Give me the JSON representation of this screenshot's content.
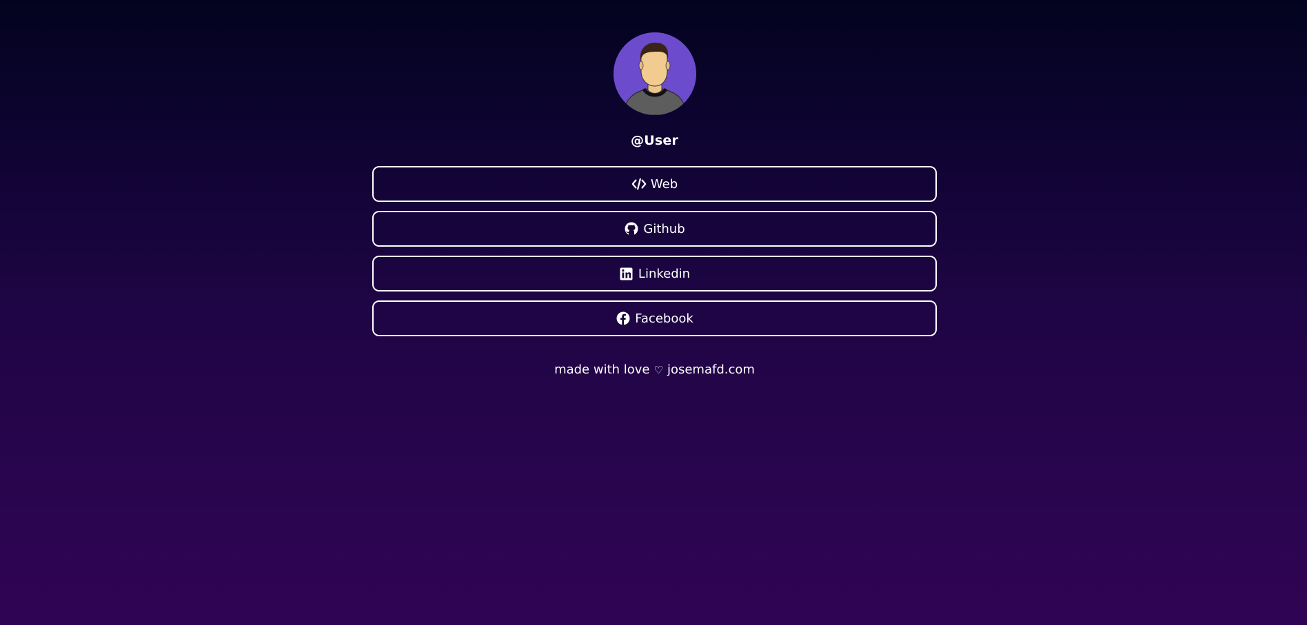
{
  "profile": {
    "username": "@User",
    "avatar_icon": "user-avatar-illustration"
  },
  "links": [
    {
      "label": "Web",
      "icon": "code-icon"
    },
    {
      "label": "Github",
      "icon": "github-icon"
    },
    {
      "label": "Linkedin",
      "icon": "linkedin-icon"
    },
    {
      "label": "Facebook",
      "icon": "facebook-icon"
    }
  ],
  "footer": {
    "prefix": "made with love",
    "heart": "♡",
    "site": "josemafd.com"
  },
  "colors": {
    "background_top": "#03031f",
    "background_bottom": "#300454",
    "avatar_bg": "#6c4ccc",
    "button_border": "#ffffff"
  }
}
